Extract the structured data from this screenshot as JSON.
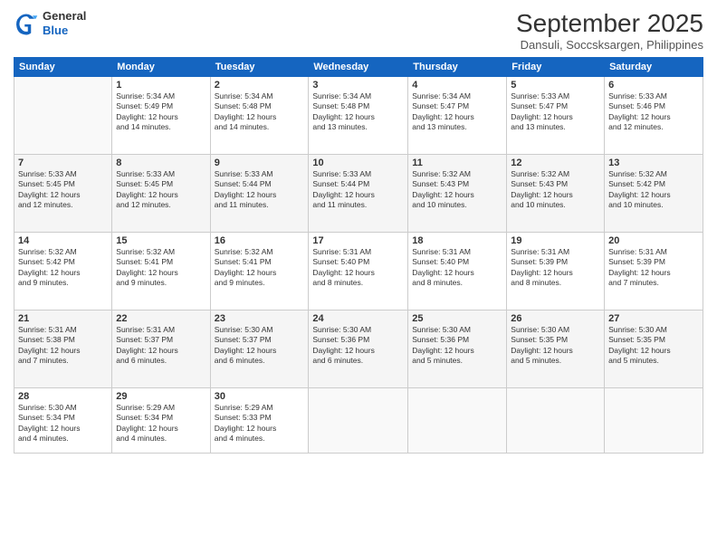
{
  "header": {
    "logo_line1": "General",
    "logo_line2": "Blue",
    "month": "September 2025",
    "location": "Dansuli, Soccsksargen, Philippines"
  },
  "weekdays": [
    "Sunday",
    "Monday",
    "Tuesday",
    "Wednesday",
    "Thursday",
    "Friday",
    "Saturday"
  ],
  "weeks": [
    [
      {
        "day": "",
        "info": ""
      },
      {
        "day": "1",
        "info": "Sunrise: 5:34 AM\nSunset: 5:49 PM\nDaylight: 12 hours\nand 14 minutes."
      },
      {
        "day": "2",
        "info": "Sunrise: 5:34 AM\nSunset: 5:48 PM\nDaylight: 12 hours\nand 14 minutes."
      },
      {
        "day": "3",
        "info": "Sunrise: 5:34 AM\nSunset: 5:48 PM\nDaylight: 12 hours\nand 13 minutes."
      },
      {
        "day": "4",
        "info": "Sunrise: 5:34 AM\nSunset: 5:47 PM\nDaylight: 12 hours\nand 13 minutes."
      },
      {
        "day": "5",
        "info": "Sunrise: 5:33 AM\nSunset: 5:47 PM\nDaylight: 12 hours\nand 13 minutes."
      },
      {
        "day": "6",
        "info": "Sunrise: 5:33 AM\nSunset: 5:46 PM\nDaylight: 12 hours\nand 12 minutes."
      }
    ],
    [
      {
        "day": "7",
        "info": "Sunrise: 5:33 AM\nSunset: 5:45 PM\nDaylight: 12 hours\nand 12 minutes."
      },
      {
        "day": "8",
        "info": "Sunrise: 5:33 AM\nSunset: 5:45 PM\nDaylight: 12 hours\nand 12 minutes."
      },
      {
        "day": "9",
        "info": "Sunrise: 5:33 AM\nSunset: 5:44 PM\nDaylight: 12 hours\nand 11 minutes."
      },
      {
        "day": "10",
        "info": "Sunrise: 5:33 AM\nSunset: 5:44 PM\nDaylight: 12 hours\nand 11 minutes."
      },
      {
        "day": "11",
        "info": "Sunrise: 5:32 AM\nSunset: 5:43 PM\nDaylight: 12 hours\nand 10 minutes."
      },
      {
        "day": "12",
        "info": "Sunrise: 5:32 AM\nSunset: 5:43 PM\nDaylight: 12 hours\nand 10 minutes."
      },
      {
        "day": "13",
        "info": "Sunrise: 5:32 AM\nSunset: 5:42 PM\nDaylight: 12 hours\nand 10 minutes."
      }
    ],
    [
      {
        "day": "14",
        "info": "Sunrise: 5:32 AM\nSunset: 5:42 PM\nDaylight: 12 hours\nand 9 minutes."
      },
      {
        "day": "15",
        "info": "Sunrise: 5:32 AM\nSunset: 5:41 PM\nDaylight: 12 hours\nand 9 minutes."
      },
      {
        "day": "16",
        "info": "Sunrise: 5:32 AM\nSunset: 5:41 PM\nDaylight: 12 hours\nand 9 minutes."
      },
      {
        "day": "17",
        "info": "Sunrise: 5:31 AM\nSunset: 5:40 PM\nDaylight: 12 hours\nand 8 minutes."
      },
      {
        "day": "18",
        "info": "Sunrise: 5:31 AM\nSunset: 5:40 PM\nDaylight: 12 hours\nand 8 minutes."
      },
      {
        "day": "19",
        "info": "Sunrise: 5:31 AM\nSunset: 5:39 PM\nDaylight: 12 hours\nand 8 minutes."
      },
      {
        "day": "20",
        "info": "Sunrise: 5:31 AM\nSunset: 5:39 PM\nDaylight: 12 hours\nand 7 minutes."
      }
    ],
    [
      {
        "day": "21",
        "info": "Sunrise: 5:31 AM\nSunset: 5:38 PM\nDaylight: 12 hours\nand 7 minutes."
      },
      {
        "day": "22",
        "info": "Sunrise: 5:31 AM\nSunset: 5:37 PM\nDaylight: 12 hours\nand 6 minutes."
      },
      {
        "day": "23",
        "info": "Sunrise: 5:30 AM\nSunset: 5:37 PM\nDaylight: 12 hours\nand 6 minutes."
      },
      {
        "day": "24",
        "info": "Sunrise: 5:30 AM\nSunset: 5:36 PM\nDaylight: 12 hours\nand 6 minutes."
      },
      {
        "day": "25",
        "info": "Sunrise: 5:30 AM\nSunset: 5:36 PM\nDaylight: 12 hours\nand 5 minutes."
      },
      {
        "day": "26",
        "info": "Sunrise: 5:30 AM\nSunset: 5:35 PM\nDaylight: 12 hours\nand 5 minutes."
      },
      {
        "day": "27",
        "info": "Sunrise: 5:30 AM\nSunset: 5:35 PM\nDaylight: 12 hours\nand 5 minutes."
      }
    ],
    [
      {
        "day": "28",
        "info": "Sunrise: 5:30 AM\nSunset: 5:34 PM\nDaylight: 12 hours\nand 4 minutes."
      },
      {
        "day": "29",
        "info": "Sunrise: 5:29 AM\nSunset: 5:34 PM\nDaylight: 12 hours\nand 4 minutes."
      },
      {
        "day": "30",
        "info": "Sunrise: 5:29 AM\nSunset: 5:33 PM\nDaylight: 12 hours\nand 4 minutes."
      },
      {
        "day": "",
        "info": ""
      },
      {
        "day": "",
        "info": ""
      },
      {
        "day": "",
        "info": ""
      },
      {
        "day": "",
        "info": ""
      }
    ]
  ]
}
